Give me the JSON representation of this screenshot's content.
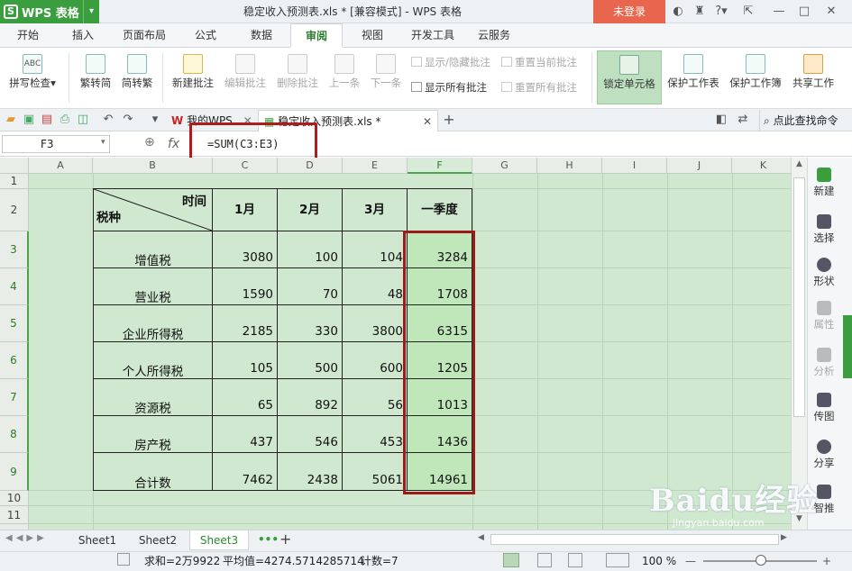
{
  "app": {
    "logo": "WPS 表格",
    "doc_title": "稳定收入预测表.xls * [兼容模式] - WPS 表格",
    "login": "未登录"
  },
  "menu_tabs": [
    "开始",
    "插入",
    "页面布局",
    "公式",
    "数据",
    "审阅",
    "视图",
    "开发工具",
    "云服务"
  ],
  "ribbon": {
    "spell_check": "拼写检查",
    "trad_to_simp": "繁转简",
    "simp_to_trad": "简转繁",
    "new_comment": "新建批注",
    "edit_comment": "编辑批注",
    "delete_comment": "删除批注",
    "prev": "上一条",
    "next": "下一条",
    "show_hide_comment": "显示/隐藏批注",
    "reset_current_comment": "重置当前批注",
    "show_all_comments": "显示所有批注",
    "reset_all_comments": "重置所有批注",
    "lock_cell": "锁定单元格",
    "protect_sheet": "保护工作表",
    "protect_book": "保护工作簿",
    "share_book": "共享工作"
  },
  "doc_tabs": {
    "mywps": "我的WPS",
    "file": "稳定收入预测表.xls *",
    "search": "点此查找命令"
  },
  "formula_bar": {
    "name_box": "F3",
    "fx": "fx",
    "formula": "=SUM(C3:E3)"
  },
  "columns": [
    "A",
    "B",
    "C",
    "D",
    "E",
    "F",
    "G",
    "H",
    "I",
    "J",
    "K"
  ],
  "rows": [
    "1",
    "2",
    "3",
    "4",
    "5",
    "6",
    "7",
    "8",
    "9",
    "10",
    "11"
  ],
  "table": {
    "header_diag_top": "时间",
    "header_diag_bottom": "税种",
    "header_cols": [
      "1月",
      "2月",
      "3月",
      "一季度"
    ],
    "rows": [
      {
        "label": "增值税",
        "values": [
          "3080",
          "100",
          "104",
          "3284"
        ]
      },
      {
        "label": "营业税",
        "values": [
          "1590",
          "70",
          "48",
          "1708"
        ]
      },
      {
        "label": "企业所得税",
        "values": [
          "2185",
          "330",
          "3800",
          "6315"
        ]
      },
      {
        "label": "个人所得税",
        "values": [
          "105",
          "500",
          "600",
          "1205"
        ]
      },
      {
        "label": "资源税",
        "values": [
          "65",
          "892",
          "56",
          "1013"
        ]
      },
      {
        "label": "房产税",
        "values": [
          "437",
          "546",
          "453",
          "1436"
        ]
      },
      {
        "label": "合计数",
        "values": [
          "7462",
          "2438",
          "5061",
          "14961"
        ]
      }
    ]
  },
  "right_panel": [
    "新建",
    "选择",
    "形状",
    "属性",
    "分析",
    "传图",
    "分享",
    "智推"
  ],
  "sheets": [
    "Sheet1",
    "Sheet2",
    "Sheet3"
  ],
  "status": {
    "sum": "求和=2万9922",
    "avg": "平均值=4274.5714285714",
    "count": "计数=7",
    "zoom": "100 %"
  },
  "watermark": {
    "main": "Baidu经验",
    "sub": "jingyan.baidu.com"
  },
  "colors": {
    "brand": "#3a9e3f",
    "login": "#e8664d",
    "highlight": "#b01c1c",
    "sheet_bg": "#cfe8cf"
  }
}
